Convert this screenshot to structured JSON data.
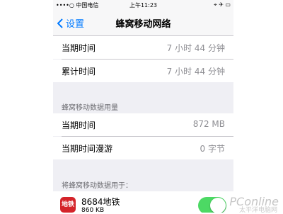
{
  "statusbar": {
    "carrier": "••••○ 中国电信",
    "time": "上午11:23",
    "right": "⌖ ✈ ▭"
  },
  "navbar": {
    "back_label": "设置",
    "title": "蜂窝移动网络"
  },
  "call_time": {
    "current_label": "当期时间",
    "current_value": "7 小时 44 分钟",
    "total_label": "累计时间",
    "total_value": "7 小时 44 分钟"
  },
  "data_usage": {
    "header": "蜂窝移动数据用量",
    "current_label": "当期时间",
    "current_value": "872 MB",
    "roaming_label": "当期时间漫游",
    "roaming_value": "0 字节"
  },
  "apps": {
    "header": "将蜂窝移动数据用于：",
    "items": [
      {
        "icon_text": "地铁",
        "name": "8684地铁",
        "size": "860 KB",
        "enabled": true
      }
    ]
  },
  "watermark": {
    "main": "PConline",
    "sub": "太平洋电脑网"
  }
}
